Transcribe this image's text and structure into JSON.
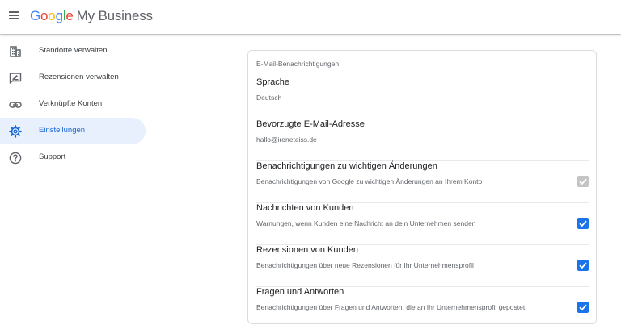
{
  "header": {
    "logo_brand": "Google",
    "logo_product": "My Business",
    "brand_colors": [
      "#4285f4",
      "#ea4335",
      "#fbbc05",
      "#4285f4",
      "#34a853",
      "#ea4335"
    ],
    "menu_icon": "hamburger-menu-icon"
  },
  "sidebar": {
    "items": [
      {
        "label": "Standorte verwalten",
        "icon": "building-icon",
        "active": false
      },
      {
        "label": "Rezensionen verwalten",
        "icon": "review-edit-icon",
        "active": false
      },
      {
        "label": "Verknüpfte Konten",
        "icon": "link-icon",
        "active": false
      },
      {
        "label": "Einstellungen",
        "icon": "gear-icon",
        "active": true
      },
      {
        "label": "Support",
        "icon": "help-circle-icon",
        "active": false
      }
    ]
  },
  "settings": {
    "section_title": "E-Mail-Benachrichtigungen",
    "rows": [
      {
        "title": "Sprache",
        "value": "Deutsch"
      },
      {
        "title": "Bevorzugte E-Mail-Adresse",
        "value": "hallo@ireneteiss.de"
      },
      {
        "title": "Benachrichtigungen zu wichtigen Änderungen",
        "value": "Benachrichtigungen von Google zu wichtigen Änderungen an Ihrem Konto",
        "checked": true,
        "disabled": true
      },
      {
        "title": "Nachrichten von Kunden",
        "value": "Warnungen, wenn Kunden eine Nachricht an dein Unternehmen senden",
        "checked": true,
        "disabled": false
      },
      {
        "title": "Rezensionen von Kunden",
        "value": "Benachrichtigungen über neue Rezensionen für Ihr Unternehmensprofil",
        "checked": true,
        "disabled": false
      },
      {
        "title": "Fragen und Antworten",
        "value": "Benachrichtigungen über Fragen und Antworten, die an Ihr Unternehmensprofil gepostet",
        "checked": true,
        "disabled": false
      }
    ]
  },
  "colors": {
    "accent": "#1a73e8",
    "active_nav_bg": "#e8f0fe",
    "active_nav_text": "#1967d2",
    "disabled_checkbox": "#c4c4c4"
  }
}
